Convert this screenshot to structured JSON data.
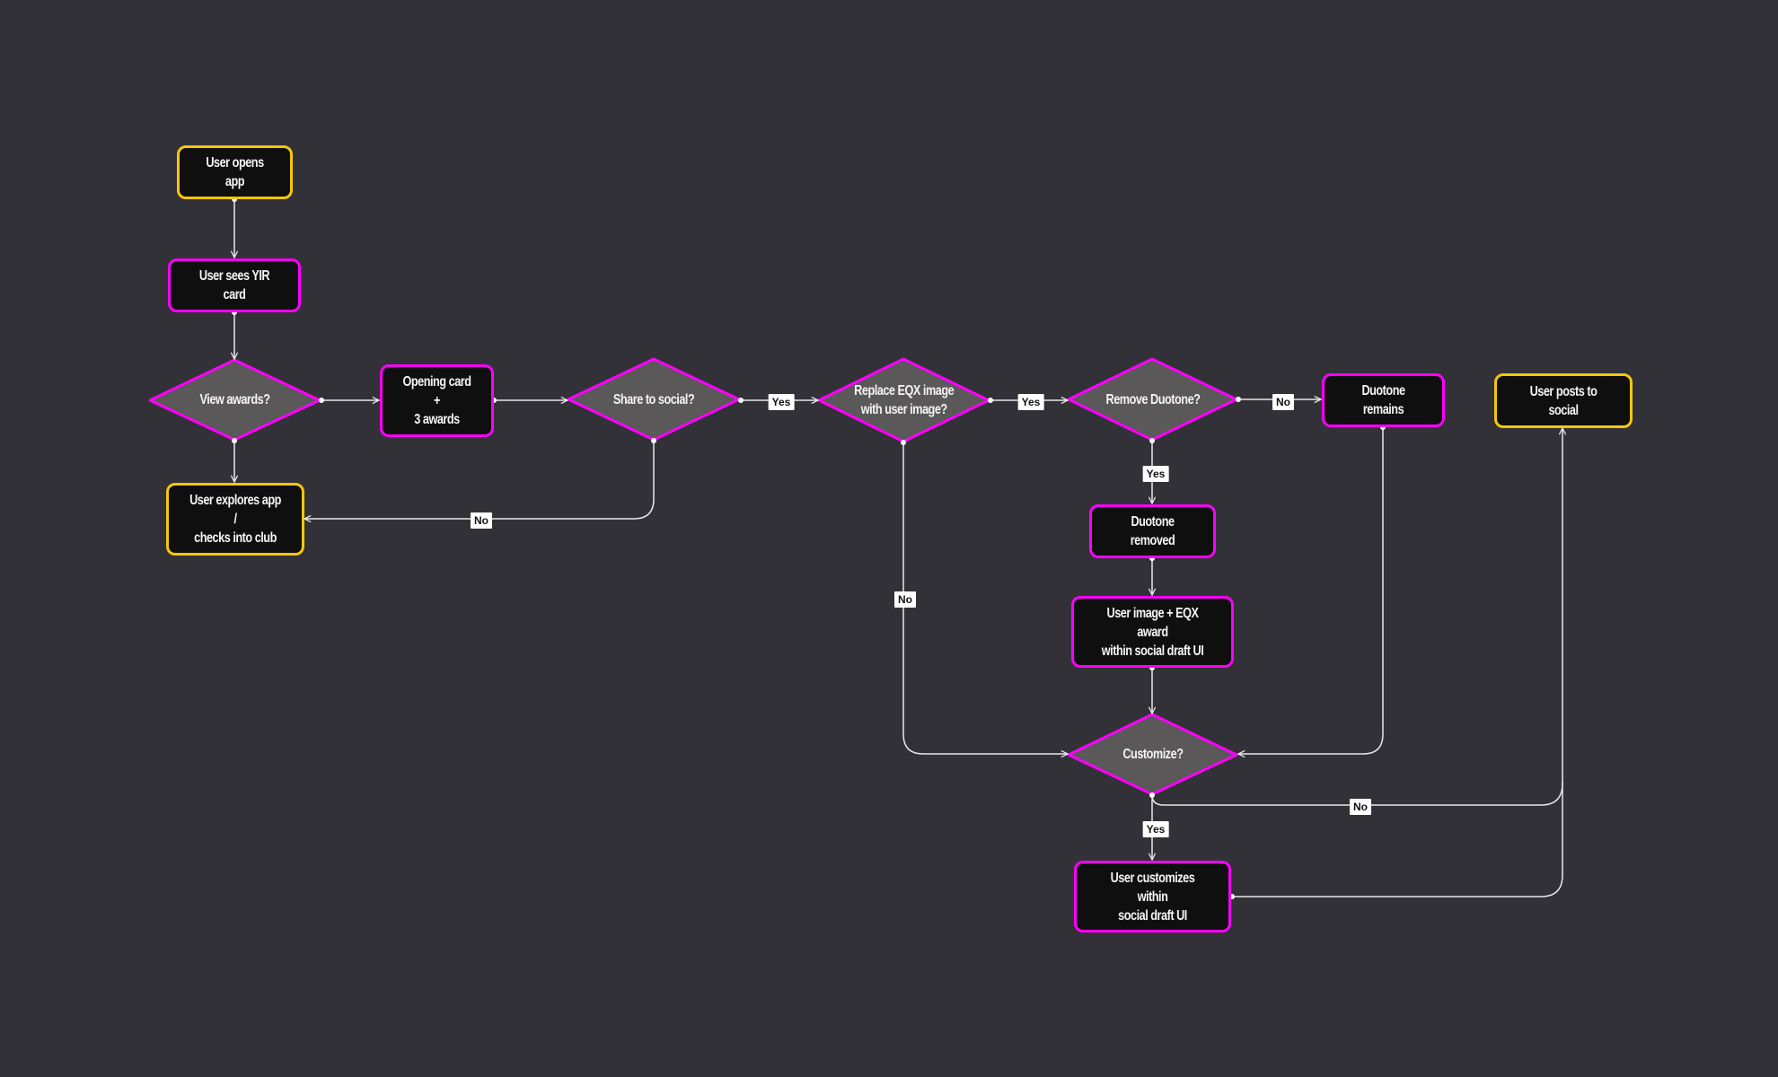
{
  "colors": {
    "background": "#323138",
    "process_border": "#ff00ff",
    "terminal_border": "#f6c70a",
    "node_fill": "#0f0f10",
    "decision_fill": "#5a5859",
    "edge": "#e8e8e8",
    "label_bg": "#ffffff"
  },
  "nodes": {
    "user_opens_app": "User opens app",
    "user_sees_yir_card": "User sees YIR card",
    "view_awards": "View awards?",
    "opening_card": "Opening card +\n3 awards",
    "share_to_social": "Share to social?",
    "replace_eqx_image": "Replace EQX image\nwith user image?",
    "remove_duotone": "Remove Duotone?",
    "duotone_remains": "Duotone remains",
    "user_posts_to_social": "User posts to social",
    "user_explores_app": "User explores app /\nchecks into club",
    "duotone_removed": "Duotone removed",
    "user_image_eqx_award": "User image + EQX award\nwithin social draft UI",
    "customize": "Customize?",
    "user_customizes": "User customizes within\nsocial draft UI"
  },
  "edge_labels": {
    "share_yes": "Yes",
    "share_no": "No",
    "replace_yes": "Yes",
    "replace_no": "No",
    "remove_yes": "Yes",
    "remove_no": "No",
    "customize_yes": "Yes",
    "customize_no": "No"
  }
}
